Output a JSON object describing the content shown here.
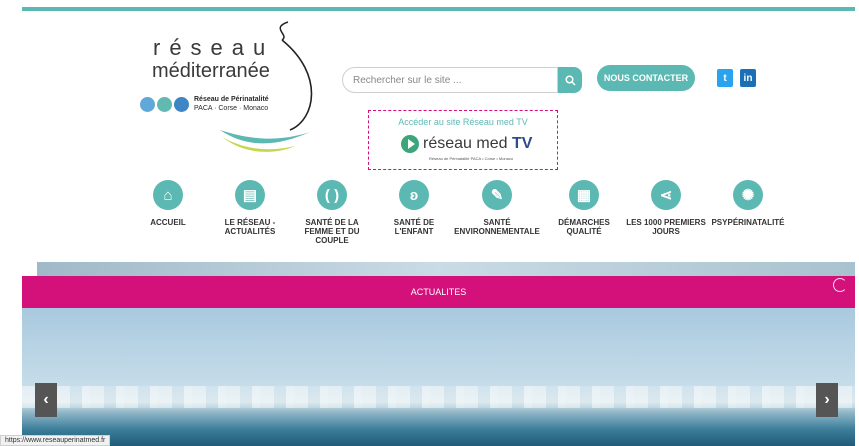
{
  "logo": {
    "line1": "réseau",
    "line2": "méditerranée",
    "tagline_bold": "Réseau de Périnatalité",
    "tagline": "PACA · Corse · Monaco"
  },
  "search": {
    "placeholder": "Rechercher sur le site ..."
  },
  "header": {
    "contact_label": "NOUS CONTACTER",
    "twitter_label": "t",
    "linkedin_label": "in"
  },
  "medtv": {
    "link": "Accéder au site Réseau med TV",
    "brand_prefix": "réseau med",
    "brand_tv": "TV",
    "sub": "Réseau de Périnatalité PACA • Corse • Monaco"
  },
  "nav": {
    "items": [
      {
        "label": "ACCUEIL",
        "icon": "home-icon",
        "glyph": "⌂"
      },
      {
        "label": "LE RÉSEAU - ACTUALITÉS",
        "icon": "newspaper-icon",
        "glyph": "▤"
      },
      {
        "label": "SANTÉ DE LA FEMME ET DU COUPLE",
        "icon": "couple-icon",
        "glyph": "( )"
      },
      {
        "label": "SANTÉ DE L'ENFANT",
        "icon": "baby-icon",
        "glyph": "ʚ"
      },
      {
        "label": "SANTÉ ENVIRONNEMENTALE",
        "icon": "leaf-icon",
        "glyph": "✎"
      },
      {
        "label": "DÉMARCHES QUALITÉ",
        "icon": "clipboard-icon",
        "glyph": "▦"
      },
      {
        "label": "LES 1000 PREMIERS JOURS",
        "icon": "share-icon",
        "glyph": "⋖"
      },
      {
        "label": "PSYPÉRINATALITÉ",
        "icon": "psy-icon",
        "glyph": "✺"
      }
    ]
  },
  "banner": {
    "title": "ACTUALITES"
  },
  "hero": {
    "prev": "‹",
    "next": "›"
  },
  "status_url": "https://www.reseauperinatmed.fr",
  "colors": {
    "teal": "#5cb8b2",
    "magenta": "#d4107a"
  }
}
